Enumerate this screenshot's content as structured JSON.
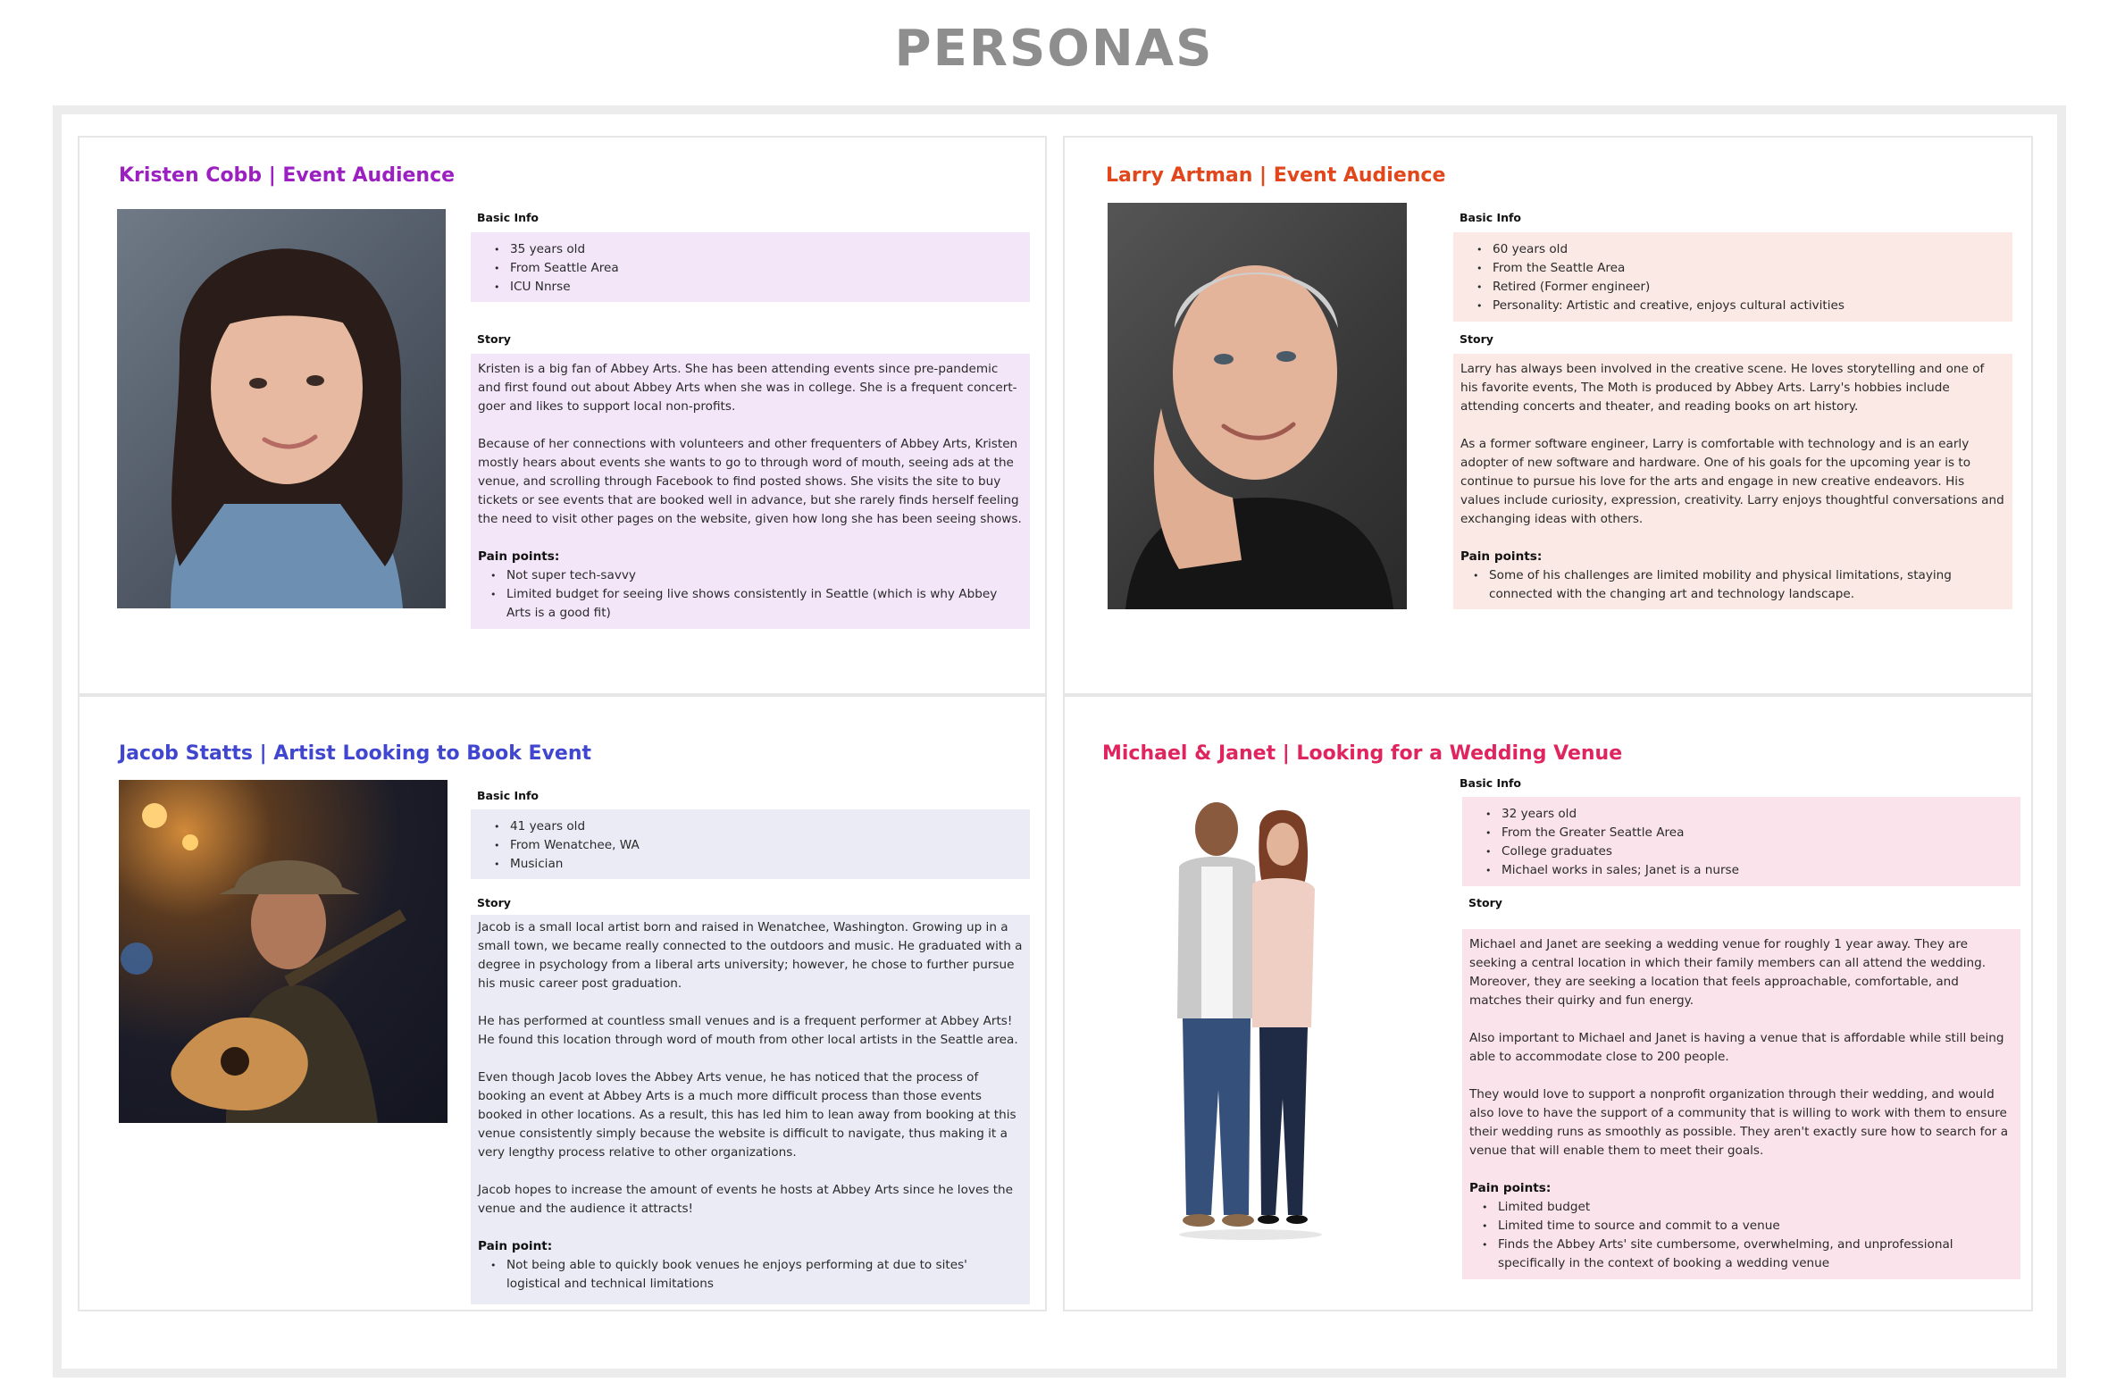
{
  "page": {
    "title": "PERSONAS"
  },
  "colors": {
    "kristen": "#9b1fc1",
    "larry": "#e2461b",
    "jacob": "#4046d0",
    "michael": "#e0245e"
  },
  "personas": [
    {
      "title": "Kristen Cobb  |  Event Audience",
      "basic_label": "Basic Info",
      "basic": [
        "35 years old",
        "From Seattle Area",
        "ICU Nnrse"
      ],
      "story_label": "Story",
      "story": [
        "Kristen is a big fan of Abbey Arts. She has been attending events since pre-pandemic and first found out about Abbey Arts when she was in college. She is a frequent concert-goer and likes to support local non-profits.",
        "Because of her connections with volunteers and other frequenters of Abbey Arts, Kristen mostly hears about events she wants to go to through word of mouth, seeing ads at the venue, and scrolling through Facebook to find posted shows. She visits the site to buy tickets or see events that are booked well in advance, but she rarely finds herself feeling the need to visit other pages on the website, given how long she has been seeing shows."
      ],
      "pain_label": "Pain points:",
      "pain": [
        "Not super tech-savvy",
        "Limited budget for seeing live shows consistently in Seattle (which is why Abbey Arts is a good fit)"
      ]
    },
    {
      "title": "Larry Artman | Event Audience",
      "basic_label": "Basic Info",
      "basic": [
        "60 years old",
        "From the Seattle Area",
        "Retired (Former engineer)",
        "Personality: Artistic and creative, enjoys cultural activities"
      ],
      "story_label": "Story",
      "story": [
        "Larry has always been involved in the creative scene. He loves storytelling and one of his favorite events, The Moth is produced by Abbey Arts. Larry's hobbies include attending concerts and theater, and reading books on art history.",
        "As a former software engineer, Larry is comfortable with technology and is an early adopter of new software and hardware. One of his goals for the upcoming year is to continue to pursue his love for the arts and engage in new creative endeavors. His values include curiosity, expression, creativity. Larry enjoys thoughtful conversations and exchanging ideas with others."
      ],
      "pain_label": "Pain points:",
      "pain": [
        "Some of his challenges are limited mobility and physical limitations, staying connected with the changing art and technology landscape."
      ]
    },
    {
      "title": "Jacob Statts  | Artist Looking to Book Event",
      "basic_label": "Basic Info",
      "basic": [
        "41 years old",
        "From Wenatchee, WA",
        "Musician"
      ],
      "story_label": "Story",
      "story": [
        "Jacob is a small local artist born and raised in Wenatchee, Washington. Growing up in a small town, we became really connected to the outdoors and music. He graduated with a degree in psychology from a liberal arts university; however, he chose to further pursue his music career post graduation.",
        "He has performed at countless small venues and is a frequent performer at Abbey Arts! He found this location through word of mouth from other local artists in the Seattle area.",
        "Even though Jacob loves the Abbey Arts venue, he has noticed that the process of booking an event at Abbey Arts is a much more difficult process than those events booked in other locations. As a result, this has led him to lean away from booking at this venue consistently simply because the website is difficult to navigate, thus making it a very lengthy process relative to other organizations.",
        "Jacob hopes to increase the amount of events he hosts at Abbey Arts since he loves the venue and the audience it attracts!"
      ],
      "pain_label": "Pain point:",
      "pain": [
        "Not being able to quickly book venues he enjoys performing at due to sites' logistical and technical limitations"
      ]
    },
    {
      "title": "Michael & Janet | Looking for a Wedding Venue",
      "basic_label": "Basic Info",
      "basic": [
        "32 years old",
        "From the Greater Seattle Area",
        "College graduates",
        "Michael works in sales; Janet is a nurse"
      ],
      "story_label": "Story",
      "story": [
        "Michael and Janet are seeking a wedding venue for roughly 1 year away. They are seeking a central location in which their family members can all attend the wedding. Moreover, they are seeking a location that feels approachable, comfortable, and matches their quirky and fun energy.",
        "Also important to Michael and Janet  is having a venue that is affordable while still being able to accommodate close to 200 people.",
        "They would love to support a nonprofit organization through their wedding, and would also love to have the support of a community that is willing to work with them to ensure their wedding runs as smoothly as possible. They aren't exactly sure how to search for a venue that will enable them to meet their goals."
      ],
      "pain_label": "Pain points:",
      "pain": [
        "Limited budget",
        "Limited time to source and commit to a venue",
        "Finds the Abbey Arts' site cumbersome, overwhelming, and unprofessional specifically in the context of booking a wedding venue"
      ]
    }
  ]
}
